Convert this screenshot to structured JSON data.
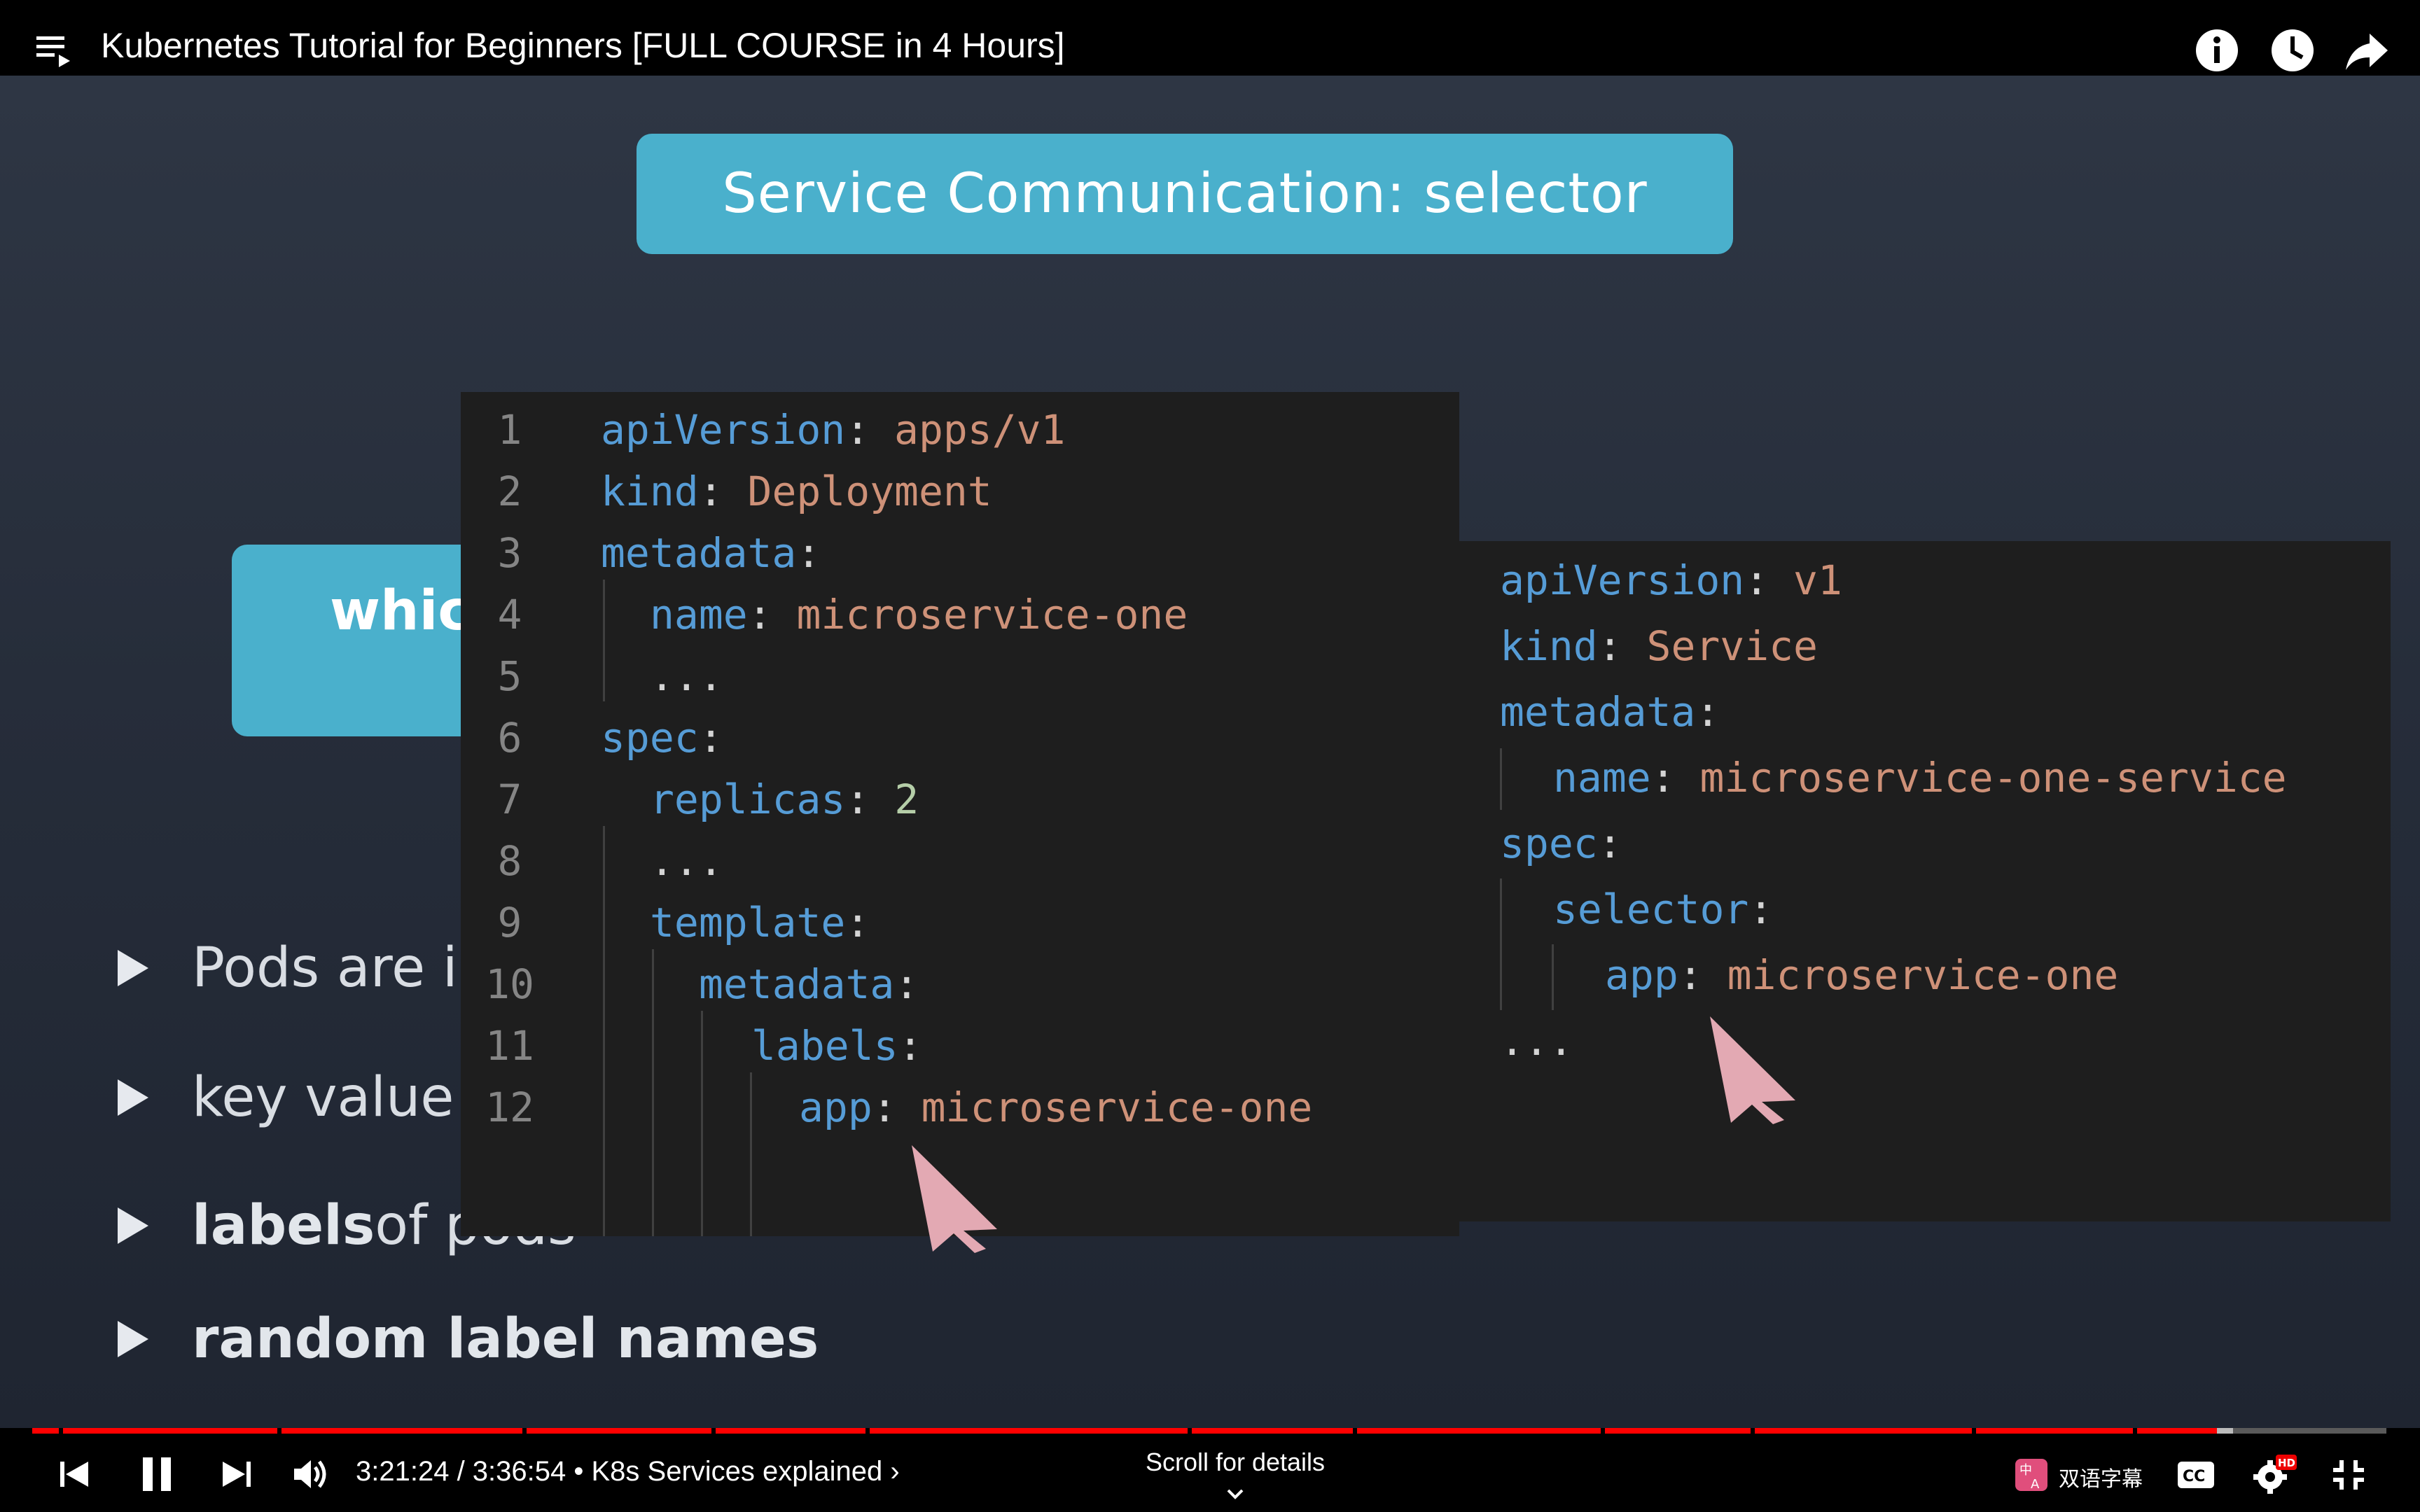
{
  "video": {
    "title": "Kubernetes Tutorial for Beginners [FULL COURSE in 4 Hours]"
  },
  "slide": {
    "title": "Service Communication: selector",
    "which_text": "whic",
    "bullets": [
      {
        "text": "Pods are i"
      },
      {
        "text": "key value"
      },
      {
        "bold": "labels",
        "rest": " of pods"
      },
      {
        "text": "random label names"
      }
    ]
  },
  "code_left": [
    {
      "num": "1",
      "key": "apiVersion",
      "sep": ": ",
      "val": "apps/v1"
    },
    {
      "num": "2",
      "key": "kind",
      "sep": ": ",
      "val": "Deployment"
    },
    {
      "num": "3",
      "key": "metadata",
      "sep": ":",
      "val": ""
    },
    {
      "num": "4",
      "key": "name",
      "sep": ": ",
      "val": "microservice-one"
    },
    {
      "num": "5",
      "key": "",
      "sep": "...",
      "val": ""
    },
    {
      "num": "6",
      "key": "spec",
      "sep": ":",
      "val": ""
    },
    {
      "num": "7",
      "key": "replicas",
      "sep": ": ",
      "val": "2"
    },
    {
      "num": "8",
      "key": "",
      "sep": "...",
      "val": ""
    },
    {
      "num": "9",
      "key": "template",
      "sep": ":",
      "val": ""
    },
    {
      "num": "10",
      "key": "metadata",
      "sep": ":",
      "val": ""
    },
    {
      "num": "11",
      "key": "labels",
      "sep": ":",
      "val": ""
    },
    {
      "num": "12",
      "key": "app",
      "sep": ": ",
      "val": "microservice-one"
    }
  ],
  "code_right": [
    {
      "key": "apiVersion",
      "sep": ": ",
      "val": "v1"
    },
    {
      "key": "kind",
      "sep": ": ",
      "val": "Service"
    },
    {
      "key": "metadata",
      "sep": ":",
      "val": ""
    },
    {
      "key": "name",
      "sep": ": ",
      "val": "microservice-one-service"
    },
    {
      "key": "spec",
      "sep": ":",
      "val": ""
    },
    {
      "key": "selector",
      "sep": ":",
      "val": ""
    },
    {
      "key": "app",
      "sep": ": ",
      "val": "microservice-one"
    },
    {
      "key": "",
      "sep": "...",
      "val": ""
    }
  ],
  "player": {
    "time_current": "3:21:24",
    "time_total": "3:36:54",
    "chapter": "K8s Services explained",
    "time_display": "3:21:24 / 3:36:54 • K8s Services explained ›",
    "scroll_hint": "Scroll for details",
    "bilingual_label": "双语字幕",
    "hd_badge": "HD",
    "progress_fraction": 0.928,
    "buffer_fraction": 0.935
  },
  "colors": {
    "accent": "#4ab0cc",
    "progress": "#ff0000",
    "yaml_key": "#569cd6",
    "yaml_value": "#ce9178",
    "yaml_number": "#b5cea8",
    "cursor": "#e3a9b3"
  },
  "icons": {
    "top": [
      "info-icon",
      "clock-icon",
      "share-icon"
    ],
    "controls": [
      "previous-icon",
      "pause-icon",
      "next-icon",
      "volume-icon",
      "bilingual-subtitle-icon",
      "cc-icon",
      "settings-icon",
      "exit-fullscreen-icon"
    ]
  }
}
